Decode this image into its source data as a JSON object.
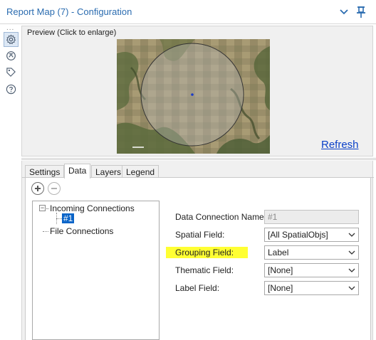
{
  "window": {
    "title": "Report Map (7) - Configuration"
  },
  "rail": {
    "dots": "...",
    "icons": [
      "gear-icon",
      "connection-icon",
      "tag-icon",
      "help-icon"
    ]
  },
  "preview": {
    "label": "Preview (Click to enlarge)",
    "refresh_label": "Refresh"
  },
  "tabs": [
    {
      "label": "Settings",
      "active": false
    },
    {
      "label": "Data",
      "active": true
    },
    {
      "label": "Layers",
      "active": false
    },
    {
      "label": "Legend",
      "active": false
    }
  ],
  "tree": {
    "incoming": {
      "label": "Incoming Connections",
      "expander": "−"
    },
    "child": {
      "label": "#1"
    },
    "file": {
      "label": "File Connections"
    }
  },
  "form": {
    "data_connection_name": {
      "label": "Data Connection Name:",
      "value": "#1"
    },
    "spatial_field": {
      "label": "Spatial Field:",
      "value": "[All SpatialObjs]"
    },
    "grouping_field": {
      "label": "Grouping Field:",
      "value": "Label"
    },
    "thematic_field": {
      "label": "Thematic Field:",
      "value": "[None]"
    },
    "label_field": {
      "label": "Label Field:",
      "value": "[None]"
    }
  },
  "colors": {
    "accent": "#2b6cb0",
    "link": "#0a40c8",
    "highlight": "#ffff33",
    "selection": "#0a64c8"
  }
}
